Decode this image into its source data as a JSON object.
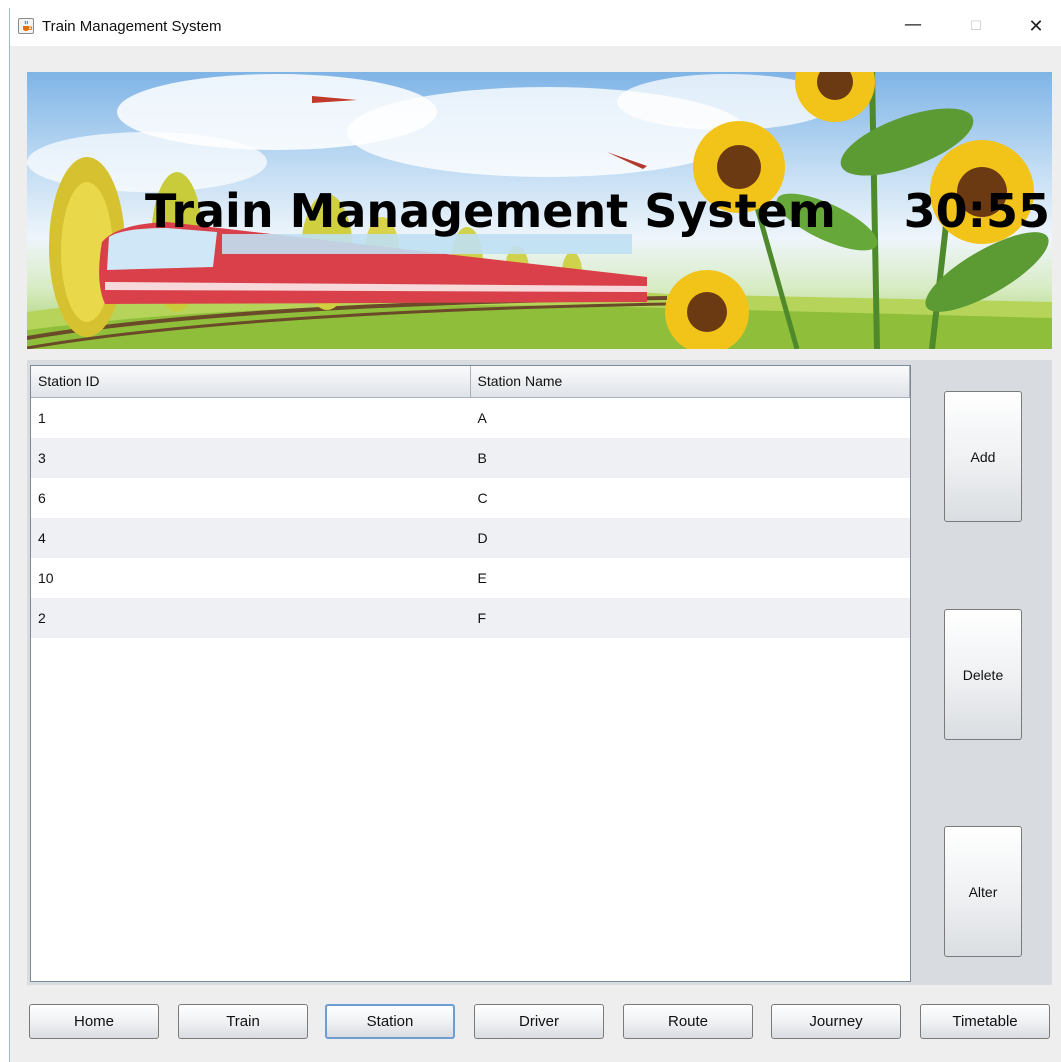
{
  "window": {
    "title": "Train Management System",
    "controls": {
      "minimize": "—",
      "maximize": "☐",
      "close": "✕"
    }
  },
  "banner": {
    "title": "Train Management System",
    "clock": "30:55"
  },
  "table": {
    "columns": [
      "Station ID",
      "Station Name"
    ],
    "rows": [
      [
        "1",
        "A"
      ],
      [
        "3",
        "B"
      ],
      [
        "6",
        "C"
      ],
      [
        "4",
        "D"
      ],
      [
        "10",
        "E"
      ],
      [
        "2",
        "F"
      ]
    ]
  },
  "actions": {
    "add": "Add",
    "delete": "Delete",
    "alter": "Alter"
  },
  "nav": {
    "items": [
      "Home",
      "Train",
      "Station",
      "Driver",
      "Route",
      "Journey",
      "Timetable"
    ],
    "active": "Station"
  },
  "colors": {
    "window_bg": "#eeeeee",
    "panel_bg": "#d8dbe0",
    "row_alt": "#eef0f3",
    "active_border": "#6e9ed1",
    "train_red": "#d9404a"
  },
  "icons": {
    "app": "java-cup-icon"
  }
}
